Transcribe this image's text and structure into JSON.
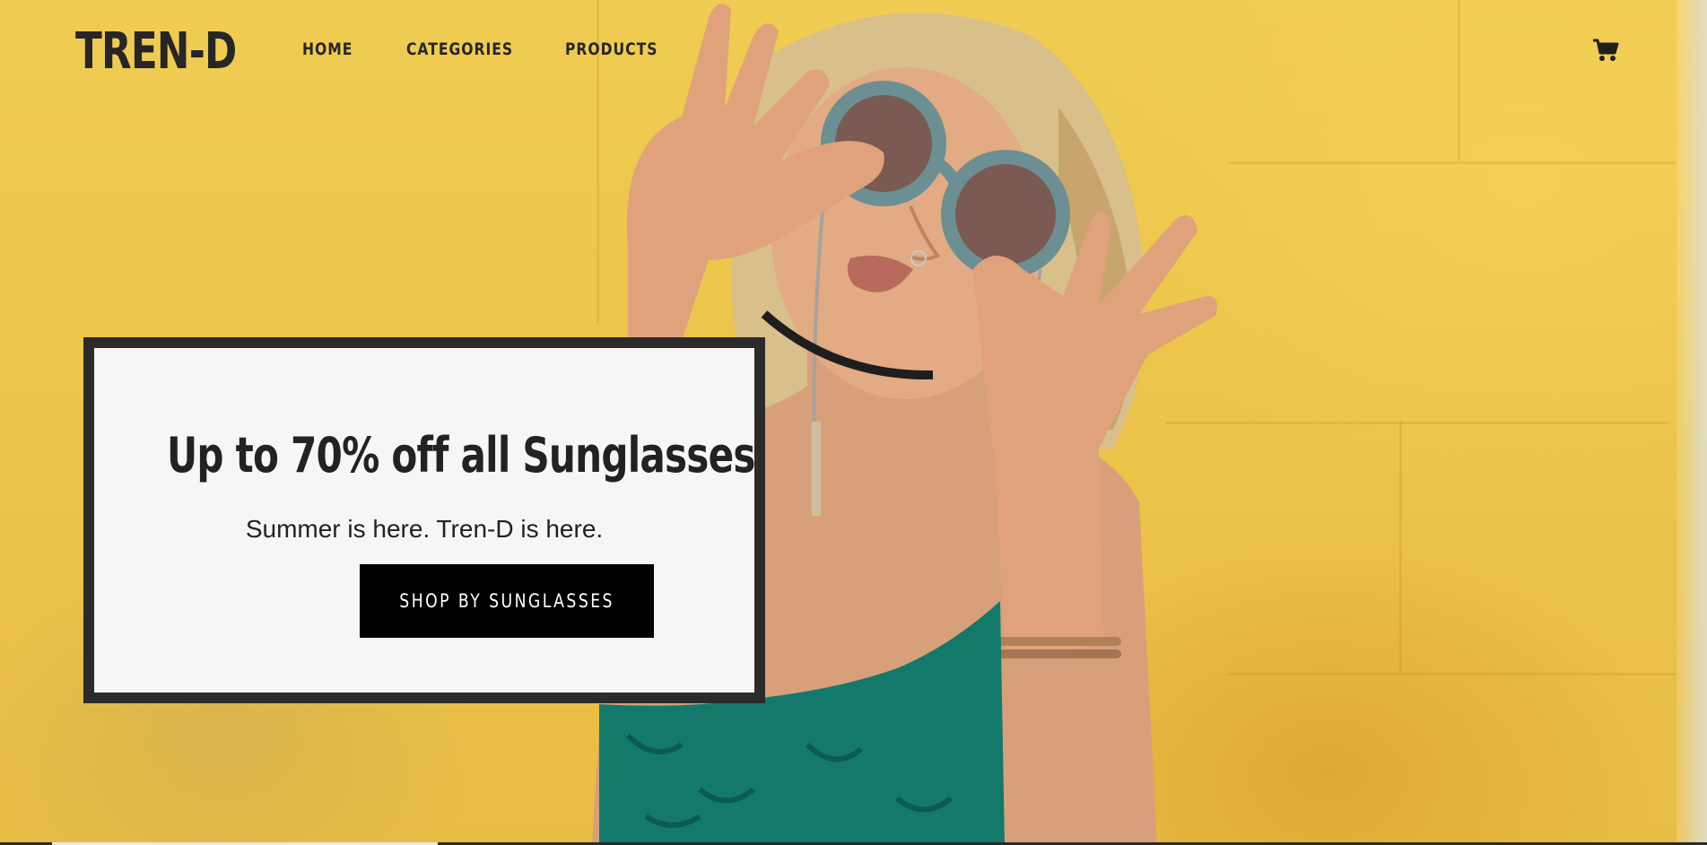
{
  "brand": {
    "logo_text": "TREN-D"
  },
  "nav": {
    "links": [
      {
        "label": "HOME"
      },
      {
        "label": "CATEGORIES"
      },
      {
        "label": "PRODUCTS"
      }
    ],
    "cart_icon": "cart-icon"
  },
  "hero": {
    "image": "model-with-round-sunglasses-yellow-wall",
    "promo": {
      "title": "Up to 70% off all Sunglasses",
      "subtitle": "Summer is here. Tren-D is here.",
      "cta_label": "SHOP BY SUNGLASSES"
    }
  },
  "colors": {
    "background_yellow": "#ecc54a",
    "text_dark": "#262626",
    "card_border": "#2b2b2b",
    "card_bg": "#f6f6f6",
    "button_bg": "#000000",
    "top_teal": "#13796b"
  }
}
